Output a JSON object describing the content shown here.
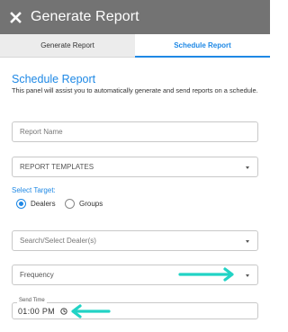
{
  "header": {
    "title": "Generate Report",
    "close_icon": "close-icon"
  },
  "tabs": [
    {
      "label": "Generate Report",
      "active": false
    },
    {
      "label": "Schedule Report",
      "active": true
    }
  ],
  "schedule": {
    "title": "Schedule Report",
    "description": "This panel will assist you to automatically generate and send reports on a schedule.",
    "report_name": {
      "placeholder": "Report Name",
      "value": ""
    },
    "templates": {
      "selected": "REPORT TEMPLATES"
    },
    "target": {
      "label": "Select Target:",
      "options": [
        {
          "label": "Dealers",
          "checked": true
        },
        {
          "label": "Groups",
          "checked": false
        }
      ]
    },
    "dealer_search": {
      "placeholder": "Search/Select Dealer(s)"
    },
    "frequency": {
      "selected": "Frequency"
    },
    "send_time": {
      "label": "Send Time",
      "value": "01:00 PM"
    }
  },
  "annotations": {
    "arrow_color": "#22d3c5"
  },
  "colors": {
    "header_bg": "#737373",
    "accent": "#1e88e5",
    "tab_inactive_bg": "#ececec"
  }
}
